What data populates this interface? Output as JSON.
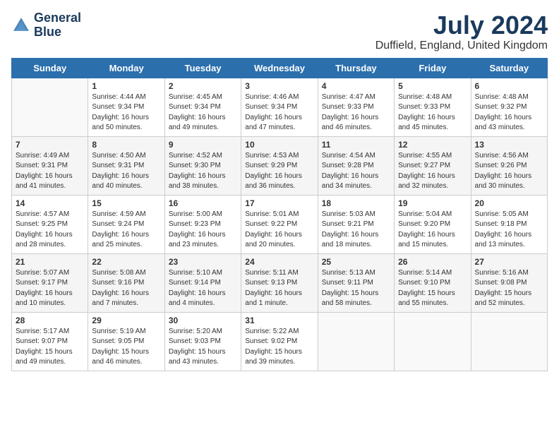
{
  "header": {
    "logo_line1": "General",
    "logo_line2": "Blue",
    "month_year": "July 2024",
    "location": "Duffield, England, United Kingdom"
  },
  "weekdays": [
    "Sunday",
    "Monday",
    "Tuesday",
    "Wednesday",
    "Thursday",
    "Friday",
    "Saturday"
  ],
  "weeks": [
    [
      {
        "day": "",
        "info": ""
      },
      {
        "day": "1",
        "info": "Sunrise: 4:44 AM\nSunset: 9:34 PM\nDaylight: 16 hours\nand 50 minutes."
      },
      {
        "day": "2",
        "info": "Sunrise: 4:45 AM\nSunset: 9:34 PM\nDaylight: 16 hours\nand 49 minutes."
      },
      {
        "day": "3",
        "info": "Sunrise: 4:46 AM\nSunset: 9:34 PM\nDaylight: 16 hours\nand 47 minutes."
      },
      {
        "day": "4",
        "info": "Sunrise: 4:47 AM\nSunset: 9:33 PM\nDaylight: 16 hours\nand 46 minutes."
      },
      {
        "day": "5",
        "info": "Sunrise: 4:48 AM\nSunset: 9:33 PM\nDaylight: 16 hours\nand 45 minutes."
      },
      {
        "day": "6",
        "info": "Sunrise: 4:48 AM\nSunset: 9:32 PM\nDaylight: 16 hours\nand 43 minutes."
      }
    ],
    [
      {
        "day": "7",
        "info": "Sunrise: 4:49 AM\nSunset: 9:31 PM\nDaylight: 16 hours\nand 41 minutes."
      },
      {
        "day": "8",
        "info": "Sunrise: 4:50 AM\nSunset: 9:31 PM\nDaylight: 16 hours\nand 40 minutes."
      },
      {
        "day": "9",
        "info": "Sunrise: 4:52 AM\nSunset: 9:30 PM\nDaylight: 16 hours\nand 38 minutes."
      },
      {
        "day": "10",
        "info": "Sunrise: 4:53 AM\nSunset: 9:29 PM\nDaylight: 16 hours\nand 36 minutes."
      },
      {
        "day": "11",
        "info": "Sunrise: 4:54 AM\nSunset: 9:28 PM\nDaylight: 16 hours\nand 34 minutes."
      },
      {
        "day": "12",
        "info": "Sunrise: 4:55 AM\nSunset: 9:27 PM\nDaylight: 16 hours\nand 32 minutes."
      },
      {
        "day": "13",
        "info": "Sunrise: 4:56 AM\nSunset: 9:26 PM\nDaylight: 16 hours\nand 30 minutes."
      }
    ],
    [
      {
        "day": "14",
        "info": "Sunrise: 4:57 AM\nSunset: 9:25 PM\nDaylight: 16 hours\nand 28 minutes."
      },
      {
        "day": "15",
        "info": "Sunrise: 4:59 AM\nSunset: 9:24 PM\nDaylight: 16 hours\nand 25 minutes."
      },
      {
        "day": "16",
        "info": "Sunrise: 5:00 AM\nSunset: 9:23 PM\nDaylight: 16 hours\nand 23 minutes."
      },
      {
        "day": "17",
        "info": "Sunrise: 5:01 AM\nSunset: 9:22 PM\nDaylight: 16 hours\nand 20 minutes."
      },
      {
        "day": "18",
        "info": "Sunrise: 5:03 AM\nSunset: 9:21 PM\nDaylight: 16 hours\nand 18 minutes."
      },
      {
        "day": "19",
        "info": "Sunrise: 5:04 AM\nSunset: 9:20 PM\nDaylight: 16 hours\nand 15 minutes."
      },
      {
        "day": "20",
        "info": "Sunrise: 5:05 AM\nSunset: 9:18 PM\nDaylight: 16 hours\nand 13 minutes."
      }
    ],
    [
      {
        "day": "21",
        "info": "Sunrise: 5:07 AM\nSunset: 9:17 PM\nDaylight: 16 hours\nand 10 minutes."
      },
      {
        "day": "22",
        "info": "Sunrise: 5:08 AM\nSunset: 9:16 PM\nDaylight: 16 hours\nand 7 minutes."
      },
      {
        "day": "23",
        "info": "Sunrise: 5:10 AM\nSunset: 9:14 PM\nDaylight: 16 hours\nand 4 minutes."
      },
      {
        "day": "24",
        "info": "Sunrise: 5:11 AM\nSunset: 9:13 PM\nDaylight: 16 hours\nand 1 minute."
      },
      {
        "day": "25",
        "info": "Sunrise: 5:13 AM\nSunset: 9:11 PM\nDaylight: 15 hours\nand 58 minutes."
      },
      {
        "day": "26",
        "info": "Sunrise: 5:14 AM\nSunset: 9:10 PM\nDaylight: 15 hours\nand 55 minutes."
      },
      {
        "day": "27",
        "info": "Sunrise: 5:16 AM\nSunset: 9:08 PM\nDaylight: 15 hours\nand 52 minutes."
      }
    ],
    [
      {
        "day": "28",
        "info": "Sunrise: 5:17 AM\nSunset: 9:07 PM\nDaylight: 15 hours\nand 49 minutes."
      },
      {
        "day": "29",
        "info": "Sunrise: 5:19 AM\nSunset: 9:05 PM\nDaylight: 15 hours\nand 46 minutes."
      },
      {
        "day": "30",
        "info": "Sunrise: 5:20 AM\nSunset: 9:03 PM\nDaylight: 15 hours\nand 43 minutes."
      },
      {
        "day": "31",
        "info": "Sunrise: 5:22 AM\nSunset: 9:02 PM\nDaylight: 15 hours\nand 39 minutes."
      },
      {
        "day": "",
        "info": ""
      },
      {
        "day": "",
        "info": ""
      },
      {
        "day": "",
        "info": ""
      }
    ]
  ]
}
